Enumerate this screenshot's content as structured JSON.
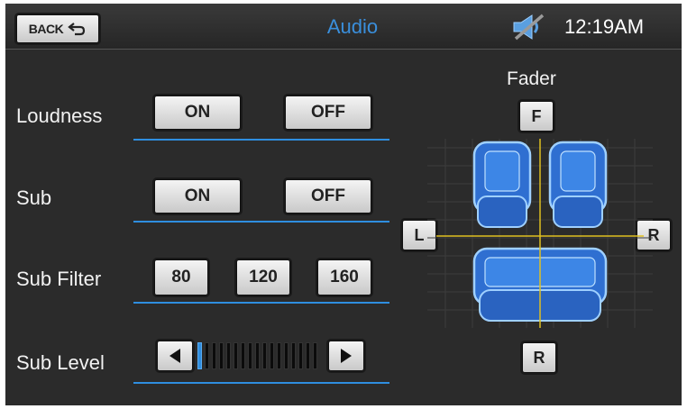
{
  "header": {
    "back_label": "BACK",
    "title": "Audio",
    "time": "12:19AM"
  },
  "rows": {
    "loudness": {
      "label": "Loudness",
      "on": "ON",
      "off": "OFF"
    },
    "sub": {
      "label": "Sub",
      "on": "ON",
      "off": "OFF"
    },
    "sub_filter": {
      "label": "Sub Filter",
      "options": [
        "80",
        "120",
        "160"
      ]
    },
    "sub_level": {
      "label": "Sub Level",
      "level": 0.05
    }
  },
  "fader": {
    "label": "Fader",
    "front": "F",
    "left": "L",
    "right": "R",
    "rear": "R"
  },
  "colors": {
    "accent": "#2f8ee0",
    "background": "#2b2b2b",
    "seat_fill": "#2f6fd1",
    "grid_line": "#e0c020"
  },
  "icons": {
    "mute": "speaker-muted-icon",
    "back": "return-arrow-icon"
  }
}
